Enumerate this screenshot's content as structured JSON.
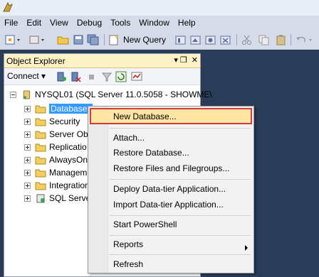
{
  "menubar": [
    "File",
    "Edit",
    "View",
    "Debug",
    "Tools",
    "Window",
    "Help"
  ],
  "toolbar": {
    "new_query_label": "New Query"
  },
  "object_explorer": {
    "title": "Object Explorer",
    "pin_glyph": "▾ ❒",
    "close_glyph": "✕",
    "connect_label": "Connect ▾",
    "server_node": "NYSQL01 (SQL Server 11.0.5058 - SHOWME\\",
    "tree": [
      "Databases",
      "Security",
      "Server Obj",
      "Replicatio",
      "AlwaysOn",
      "Managem",
      "Integration",
      "SQL Serve"
    ]
  },
  "context_menu": {
    "items": [
      "New Database...",
      "Attach...",
      "Restore Database...",
      "Restore Files and Filegroups...",
      "Deploy Data-tier Application...",
      "Import Data-tier Application...",
      "Start PowerShell",
      "Reports",
      "Refresh"
    ]
  },
  "colors": {
    "highlight": "#fde5a4",
    "highlight_border": "#d83b3b",
    "selection": "#3399ff",
    "workspace": "#2b3c59"
  }
}
